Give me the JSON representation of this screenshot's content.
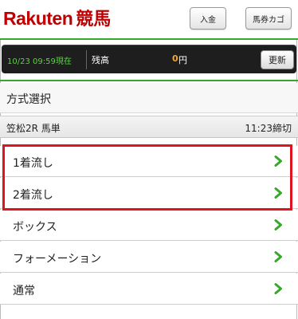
{
  "header": {
    "logo_text": "Rakuten",
    "logo_keiba": "競馬",
    "deposit_label": "入金",
    "cart_label": "馬券カゴ"
  },
  "status": {
    "datetime": "10/23 09:59現在",
    "balance_label": "残高",
    "balance_amount": "0",
    "balance_unit": "円",
    "refresh_label": "更新",
    "time_color": "#5fd046",
    "amount_color": "#f5a623"
  },
  "section": {
    "title": "方式選択"
  },
  "race": {
    "name": "笠松2R 馬単",
    "deadline": "11:23締切"
  },
  "menu": {
    "items": [
      {
        "label": "1着流し",
        "icon": "chevron-right-icon"
      },
      {
        "label": "2着流し",
        "icon": "chevron-right-icon"
      },
      {
        "label": "ボックス",
        "icon": "chevron-right-icon"
      },
      {
        "label": "フォーメーション",
        "icon": "chevron-right-icon"
      },
      {
        "label": "通常",
        "icon": "chevron-right-icon"
      }
    ]
  },
  "colors": {
    "brand": "#bf0000",
    "accent_green": "#36a82a",
    "highlight": "#e0141e"
  }
}
